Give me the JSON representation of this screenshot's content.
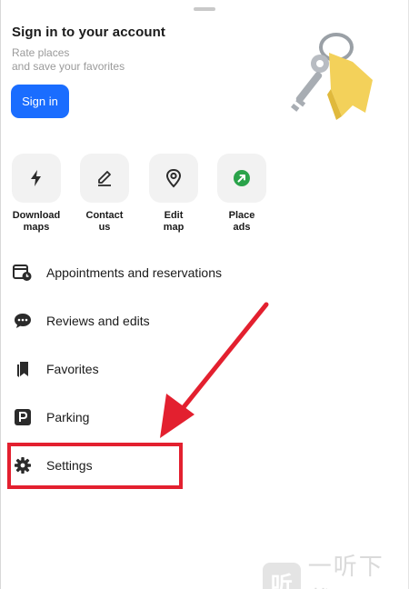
{
  "header": {
    "title": "Sign in to your account",
    "subtitle_line1": "Rate places",
    "subtitle_line2": "and save your favorites",
    "signin_label": "Sign in"
  },
  "quick_actions": [
    {
      "line1": "Download",
      "line2": "maps",
      "icon": "lightning-icon"
    },
    {
      "line1": "Contact",
      "line2": "us",
      "icon": "pencil-icon"
    },
    {
      "line1": "Edit",
      "line2": "map",
      "icon": "map-pin-icon"
    },
    {
      "line1": "Place",
      "line2": "ads",
      "icon": "arrow-circle-icon"
    }
  ],
  "menu": [
    {
      "label": "Appointments and reservations",
      "icon": "calendar-clock-icon"
    },
    {
      "label": "Reviews and edits",
      "icon": "chat-bubble-icon"
    },
    {
      "label": "Favorites",
      "icon": "bookmarks-icon"
    },
    {
      "label": "Parking",
      "icon": "parking-icon"
    },
    {
      "label": "Settings",
      "icon": "gear-icon"
    }
  ],
  "watermark": {
    "logo": "听",
    "text": "一听下载"
  },
  "colors": {
    "accent": "#1a6dff",
    "highlight": "#e3202f",
    "ads_green": "#2aa34a",
    "key_yellow": "#f5d35a"
  }
}
